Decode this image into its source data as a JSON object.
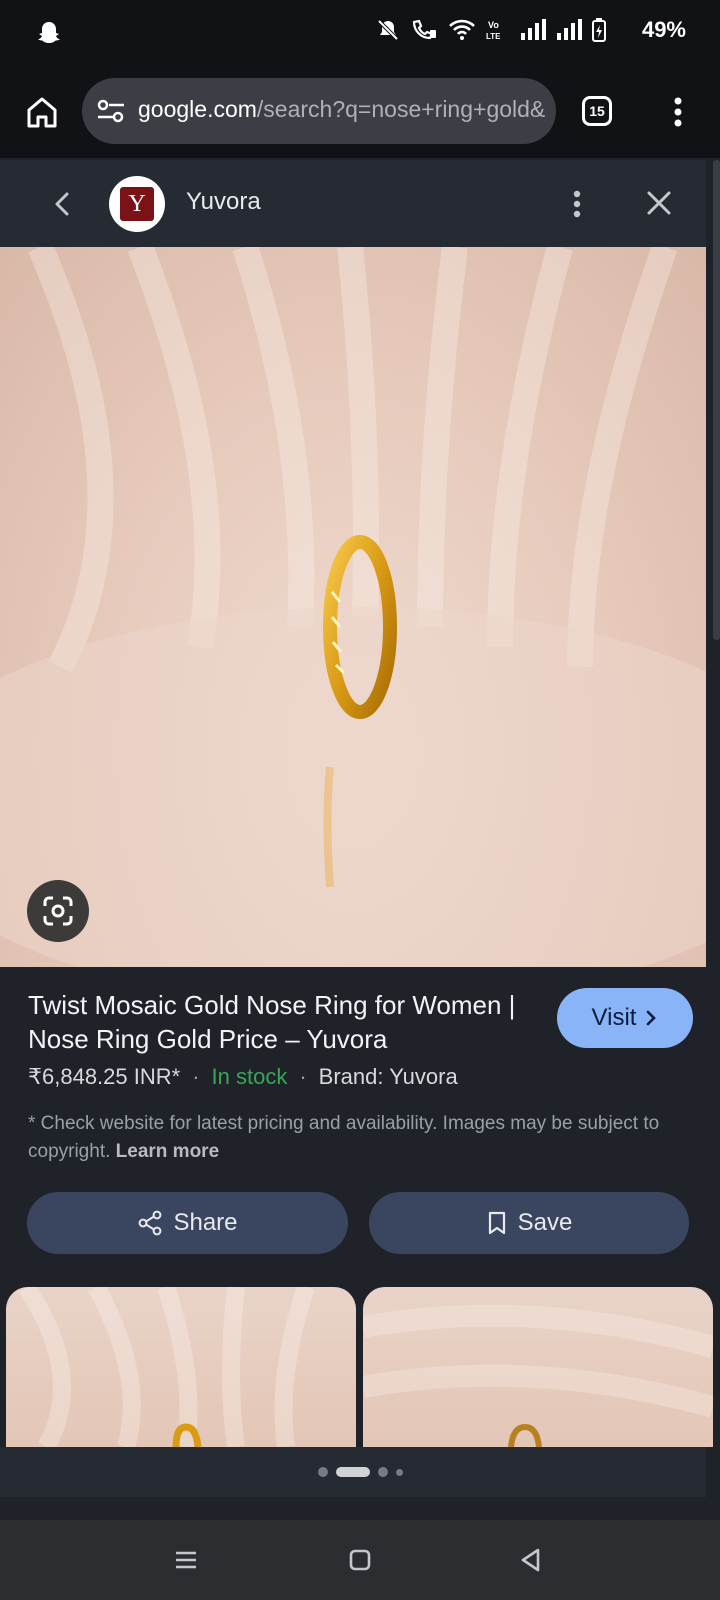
{
  "status_bar": {
    "battery": "49%",
    "icons": [
      "snapchat-ghost-icon",
      "mute-icon",
      "wifi-calling-icon",
      "wifi-icon",
      "volte-icon",
      "signal-icon",
      "signal-icon",
      "battery-charging-icon"
    ]
  },
  "browser": {
    "url_host": "google.com",
    "url_rest": "/search?q=nose+ring+gold&",
    "tab_count": "15"
  },
  "panel": {
    "site_name": "Yuvora",
    "logo_letter": "Y"
  },
  "product": {
    "title": "Twist Mosaic Gold Nose Ring for Women | Nose Ring Gold Price – Yuvora",
    "price": "₹6,848.25 INR*",
    "stock": "In stock",
    "brand": "Brand: Yuvora",
    "separator": "·",
    "disclaimer": "* Check website for latest pricing and availability. Images may be subject to copyright.",
    "learn_more": "Learn more",
    "visit_label": "Visit",
    "share_label": "Share",
    "save_label": "Save"
  },
  "pager": {
    "pages": 4,
    "active": 1
  },
  "colors": {
    "accent": "#8ab4f8",
    "stock_green": "#3aa657",
    "button_bg": "#3a4660"
  }
}
